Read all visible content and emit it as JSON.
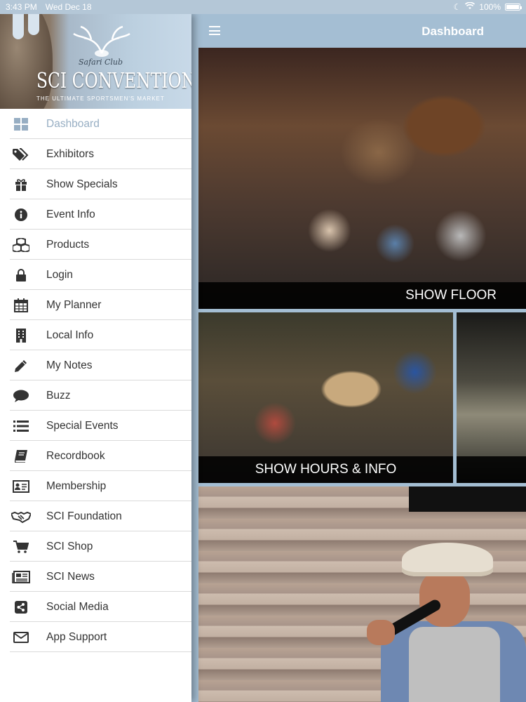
{
  "status": {
    "time": "3:43 PM",
    "date": "Wed Dec 18",
    "battery": "100%"
  },
  "logo": {
    "script": "Safari Club",
    "main": "SCI CONVENTION",
    "tagline": "THE ULTIMATE SPORTSMEN'S MARKET"
  },
  "header": {
    "title": "Dashboard"
  },
  "menu": {
    "items": [
      {
        "label": "Dashboard",
        "icon": "dashboard-icon"
      },
      {
        "label": "Exhibitors",
        "icon": "tags-icon"
      },
      {
        "label": "Show Specials",
        "icon": "gift-icon"
      },
      {
        "label": "Event Info",
        "icon": "info-icon"
      },
      {
        "label": "Products",
        "icon": "cubes-icon"
      },
      {
        "label": "Login",
        "icon": "lock-icon"
      },
      {
        "label": "My Planner",
        "icon": "calendar-icon"
      },
      {
        "label": "Local Info",
        "icon": "building-icon"
      },
      {
        "label": "My Notes",
        "icon": "pencil-icon"
      },
      {
        "label": "Buzz",
        "icon": "speech-bubble-icon"
      },
      {
        "label": "Special Events",
        "icon": "list-icon"
      },
      {
        "label": "Recordbook",
        "icon": "book-icon"
      },
      {
        "label": "Membership",
        "icon": "id-card-icon"
      },
      {
        "label": "SCI Foundation",
        "icon": "handshake-icon"
      },
      {
        "label": "SCI Shop",
        "icon": "cart-icon"
      },
      {
        "label": "SCI News",
        "icon": "newspaper-icon"
      },
      {
        "label": "Social Media",
        "icon": "share-icon"
      },
      {
        "label": "App Support",
        "icon": "envelope-icon"
      }
    ]
  },
  "tiles": {
    "show_floor": "SHOW FLOOR",
    "show_hours": "SHOW HOURS & INFO"
  },
  "colors": {
    "accent": "#97aec3",
    "header_bg": "#a4bed3",
    "caption_bg": "#000000"
  }
}
